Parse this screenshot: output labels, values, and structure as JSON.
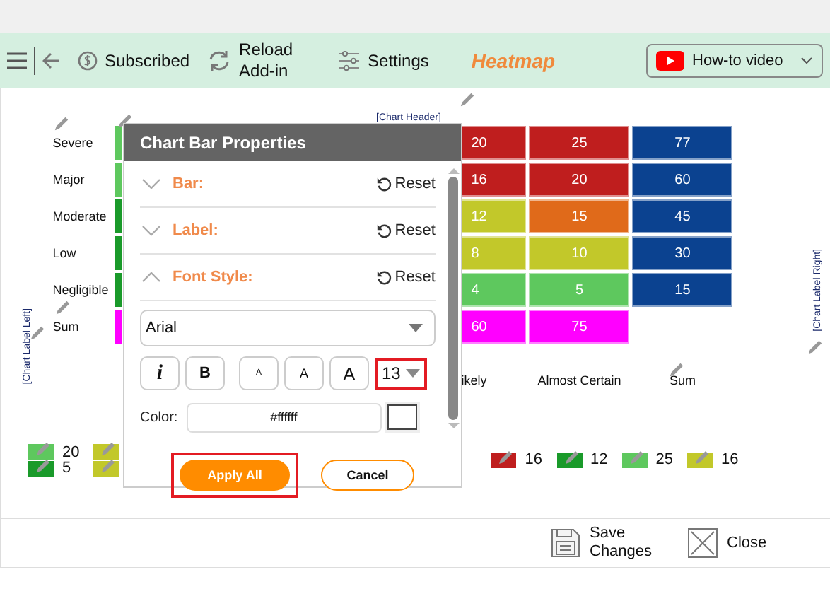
{
  "toolbar": {
    "subscribed": "Subscribed",
    "reload": "Reload Add-in",
    "settings": "Settings",
    "title": "Heatmap",
    "video_button": "How-to video"
  },
  "chart": {
    "header": "[Chart Header]",
    "label_left": "[Chart Label Left]",
    "label_right": "[Chart Label Right]",
    "rows": [
      {
        "label": "Severe",
        "cells": [
          {
            "color": "#5ec85e"
          },
          {
            "text": "20",
            "color": "#bf1e1e"
          },
          {
            "text": "25",
            "color": "#bf1e1e"
          },
          {
            "text": "77",
            "color": "#0b4290"
          }
        ]
      },
      {
        "label": "Major",
        "cells": [
          {
            "color": "#5ec85e"
          },
          {
            "text": "16",
            "color": "#bf1e1e"
          },
          {
            "text": "20",
            "color": "#bf1e1e"
          },
          {
            "text": "60",
            "color": "#0b4290"
          }
        ]
      },
      {
        "label": "Moderate",
        "cells": [
          {
            "color": "#1a9a2a"
          },
          {
            "text": "12",
            "color": "#c2c82a"
          },
          {
            "text": "15",
            "color": "#e06a1a"
          },
          {
            "text": "45",
            "color": "#0b4290"
          }
        ]
      },
      {
        "label": "Low",
        "cells": [
          {
            "color": "#1a9a2a"
          },
          {
            "text": "8",
            "color": "#c2c82a"
          },
          {
            "text": "10",
            "color": "#c2c82a"
          },
          {
            "text": "30",
            "color": "#0b4290"
          }
        ]
      },
      {
        "label": "Negligible",
        "cells": [
          {
            "color": "#1a9a2a"
          },
          {
            "text": "4",
            "color": "#5ec85e"
          },
          {
            "text": "5",
            "color": "#5ec85e"
          },
          {
            "text": "15",
            "color": "#0b4290"
          }
        ]
      },
      {
        "label": "Sum",
        "cells": [
          {
            "color": "#ff00ff"
          },
          {
            "text": "60",
            "color": "#ff00ff"
          },
          {
            "text": "75",
            "color": "#ff00ff"
          }
        ]
      }
    ],
    "column_labels": [
      "ikely",
      "Almost Certain",
      "Sum"
    ],
    "legend": [
      {
        "swatches": [
          {
            "color": "#5ec85e"
          },
          {
            "color": "#1a9a2a"
          }
        ],
        "values": [
          "20",
          "5"
        ]
      },
      {
        "swatches": [
          {
            "color": "#c2c82a"
          },
          {
            "color": "#c2c82a"
          }
        ]
      },
      {
        "swatches": [
          {
            "color": "#bf1e1e"
          }
        ],
        "values": [
          "16"
        ]
      },
      {
        "swatches": [
          {
            "color": "#1a9a2a"
          }
        ],
        "values": [
          "12"
        ]
      },
      {
        "swatches": [
          {
            "color": "#5ec85e"
          }
        ],
        "values": [
          "25"
        ]
      },
      {
        "swatches": [
          {
            "color": "#c2c82a"
          }
        ],
        "values": [
          "16"
        ]
      }
    ]
  },
  "dialog": {
    "title": "Chart Bar Properties",
    "sections": [
      {
        "label": "Bar:",
        "expanded": false,
        "reset": "Reset"
      },
      {
        "label": "Label:",
        "expanded": false,
        "reset": "Reset"
      },
      {
        "label": "Font Style:",
        "expanded": true,
        "reset": "Reset"
      }
    ],
    "font_family": "Arial",
    "style_buttons": [
      {
        "text": "i",
        "kind": "italic"
      },
      {
        "text": "B",
        "kind": "bold"
      },
      {
        "text": "A",
        "kind": "small"
      },
      {
        "text": "A",
        "kind": "medium"
      },
      {
        "text": "A",
        "kind": "large"
      }
    ],
    "font_size": "13",
    "font_size_highlighted": true,
    "color_label": "Color:",
    "color_value": "#ffffff",
    "buttons": [
      {
        "label": "Apply All",
        "kind": "primary",
        "highlighted": true
      },
      {
        "label": "Cancel",
        "kind": "secondary",
        "highlighted": false
      }
    ]
  },
  "footer": {
    "buttons": [
      {
        "label": "Save Changes",
        "kind": "save"
      },
      {
        "label": "Close",
        "kind": "close"
      }
    ]
  }
}
